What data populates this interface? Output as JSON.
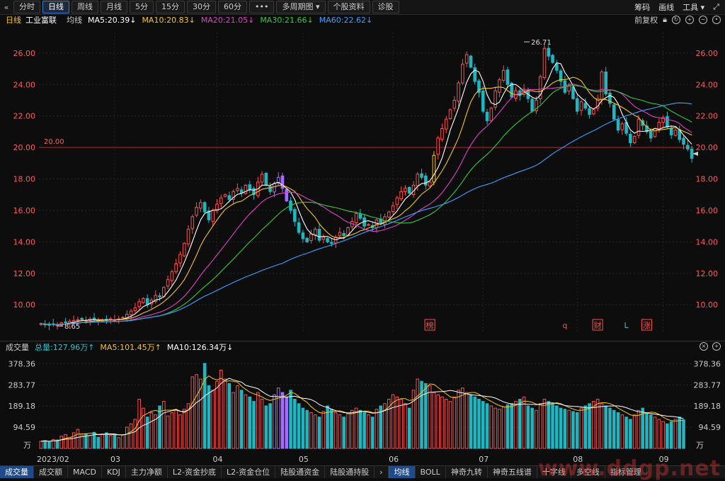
{
  "toolbar": {
    "nav_prev": "«",
    "periods": [
      "分时",
      "日线",
      "周线",
      "月线",
      "5分",
      "15分",
      "30分",
      "60分"
    ],
    "active_period": "日线",
    "more": "•••",
    "multi_period": "多周期图",
    "stock_info": "个股资料",
    "diagnose": "诊股",
    "right": [
      "筹码",
      "画线",
      "工具"
    ]
  },
  "info": {
    "period": "日线",
    "stock_name": "工业富联",
    "ma_label": "均线",
    "ma": [
      {
        "text": "MA5:20.39",
        "arrow": "↓",
        "color": "#ffffff"
      },
      {
        "text": "MA10:20.83",
        "arrow": "↓",
        "color": "#f5c518"
      },
      {
        "text": "MA20:21.05",
        "arrow": "↓",
        "color": "#e040c8"
      },
      {
        "text": "MA30:21.66",
        "arrow": "↓",
        "color": "#2ecc40"
      },
      {
        "text": "MA60:22.62",
        "arrow": "↓",
        "color": "#3aa0ff"
      }
    ],
    "adjust": "前复权"
  },
  "chart_data": [
    {
      "type": "candlestick",
      "title": "",
      "y_ticks": [
        "26.00",
        "24.00",
        "22.00",
        "20.00",
        "18.00",
        "16.00",
        "14.00",
        "12.00",
        "10.00"
      ],
      "ylim": [
        8.3,
        27.3
      ],
      "x_ticks": [
        "2023/02",
        "03",
        "04",
        "05",
        "06",
        "07",
        "08",
        "09"
      ],
      "x_tick_index": [
        0,
        18,
        43,
        64,
        86,
        108,
        131,
        152
      ],
      "reference_line": {
        "value": 20.0,
        "label": "20.00"
      },
      "annotations": [
        {
          "label": "8.65",
          "value": 8.65,
          "index": 4
        },
        {
          "label": "26.71",
          "value": 26.71,
          "index": 118
        }
      ],
      "event_markers": [
        {
          "label": "榜",
          "index": 95,
          "color": "#ff4d4d",
          "boxed": true
        },
        {
          "label": "q",
          "index": 128,
          "color": "#ff4d4d",
          "boxed": false
        },
        {
          "label": "财",
          "index": 136,
          "color": "#ff4d4d",
          "boxed": true
        },
        {
          "label": "L",
          "index": 143,
          "color": "#29c0c8",
          "boxed": false
        },
        {
          "label": "涨",
          "index": 148,
          "color": "#ff4d4d",
          "boxed": true
        }
      ],
      "closes": [
        8.8,
        8.75,
        8.7,
        8.75,
        8.7,
        8.85,
        8.9,
        8.95,
        9.0,
        9.05,
        9.05,
        9.0,
        9.1,
        9.05,
        9.0,
        9.05,
        9.0,
        9.1,
        9.05,
        9.1,
        9.2,
        9.4,
        9.6,
        9.8,
        10.2,
        10.4,
        10.0,
        10.3,
        10.6,
        10.5,
        11.1,
        11.6,
        12.1,
        12.6,
        13.2,
        13.9,
        14.8,
        15.6,
        16.2,
        16.5,
        15.9,
        15.4,
        16.0,
        16.4,
        16.8,
        17.0,
        16.7,
        17.2,
        17.4,
        17.1,
        17.6,
        17.3,
        17.0,
        17.8,
        18.3,
        17.6,
        17.2,
        17.7,
        18.1,
        17.4,
        16.6,
        16.0,
        15.3,
        14.6,
        14.2,
        14.0,
        14.5,
        14.8,
        14.1,
        14.3,
        14.0,
        13.9,
        14.3,
        14.6,
        14.4,
        14.9,
        15.3,
        15.8,
        15.5,
        15.0,
        15.1,
        14.9,
        15.4,
        15.2,
        15.6,
        15.9,
        16.3,
        16.8,
        17.2,
        17.4,
        17.1,
        17.6,
        18.3,
        18.1,
        17.6,
        17.8,
        19.5,
        20.6,
        21.2,
        21.8,
        22.4,
        23.0,
        24.1,
        25.3,
        25.9,
        25.1,
        24.2,
        23.5,
        22.3,
        21.7,
        22.5,
        23.6,
        24.3,
        24.9,
        24.0,
        23.2,
        23.6,
        23.3,
        23.7,
        23.1,
        22.3,
        23.0,
        24.5,
        26.3,
        25.8,
        25.4,
        24.9,
        24.2,
        23.5,
        23.9,
        23.1,
        22.3,
        22.9,
        22.5,
        22.1,
        22.4,
        23.1,
        24.8,
        23.4,
        22.8,
        21.8,
        21.1,
        21.5,
        20.9,
        20.3,
        20.7,
        21.8,
        21.4,
        21.0,
        20.6,
        21.2,
        21.6,
        21.9,
        21.3,
        20.8,
        21.1,
        20.5,
        20.2,
        19.9,
        19.3
      ],
      "ma_series": [
        {
          "name": "MA5",
          "color": "#ffffff",
          "window": 5
        },
        {
          "name": "MA10",
          "color": "#f5c518",
          "window": 10
        },
        {
          "name": "MA20",
          "color": "#e040c8",
          "window": 20
        },
        {
          "name": "MA30",
          "color": "#2ecc40",
          "window": 30
        },
        {
          "name": "MA60",
          "color": "#3aa0ff",
          "window": 60
        }
      ]
    },
    {
      "type": "bar",
      "title": "成交量",
      "y_ticks": [
        "378.36",
        "283.77",
        "189.18",
        "94.59"
      ],
      "ylim": [
        0,
        405
      ],
      "unit": "万",
      "values": [
        32,
        35,
        28,
        40,
        38,
        55,
        62,
        48,
        70,
        85,
        60,
        66,
        58,
        72,
        50,
        64,
        70,
        58,
        62,
        48,
        60,
        95,
        110,
        130,
        220,
        180,
        140,
        160,
        150,
        190,
        210,
        145,
        160,
        170,
        150,
        175,
        200,
        320,
        330,
        310,
        380,
        280,
        260,
        300,
        350,
        310,
        290,
        250,
        280,
        260,
        240,
        230,
        210,
        250,
        220,
        190,
        200,
        240,
        270,
        250,
        230,
        260,
        220,
        200,
        180,
        170,
        160,
        150,
        140,
        165,
        190,
        175,
        160,
        150,
        140,
        155,
        170,
        180,
        170,
        160,
        150,
        140,
        175,
        190,
        200,
        220,
        240,
        230,
        220,
        200,
        180,
        260,
        310,
        300,
        290,
        280,
        250,
        240,
        230,
        220,
        210,
        230,
        260,
        270,
        250,
        240,
        230,
        220,
        210,
        200,
        190,
        180,
        175,
        185,
        195,
        200,
        210,
        220,
        230,
        190,
        180,
        170,
        200,
        220,
        210,
        200,
        190,
        180,
        175,
        170,
        165,
        160,
        180,
        190,
        200,
        210,
        220,
        200,
        190,
        180,
        170,
        160,
        150,
        140,
        130,
        150,
        170,
        180,
        160,
        150,
        140,
        130,
        120,
        110,
        120,
        130,
        140,
        128
      ],
      "series_info": [
        {
          "text": "总量:127.96万",
          "arrow": "↑",
          "color": "#29c0c8"
        },
        {
          "text": "MA5:101.45万",
          "arrow": "↑",
          "color": "#f5c518"
        },
        {
          "text": "MA10:126.34万",
          "arrow": "↓",
          "color": "#ffffff"
        }
      ]
    }
  ],
  "bottom_tabs": [
    "成交量",
    "成交额",
    "MACD",
    "KDJ",
    "主力净额",
    "L2-资金抄底",
    "L2-资金仓位",
    "陆股通资金",
    "陆股通持股",
    "均线",
    "BOLL",
    "神奇九转",
    "神奇五线谱",
    "十字线",
    "多空线",
    "指标管理"
  ],
  "active_tabs": [
    "成交量",
    "均线"
  ],
  "nav_arrow": "›",
  "watermark": "www.ddgp.net",
  "colors": {
    "up": "#ff4d4d",
    "down": "#1fb6c0",
    "limit": "#f5c518",
    "special": "#a66cff"
  }
}
